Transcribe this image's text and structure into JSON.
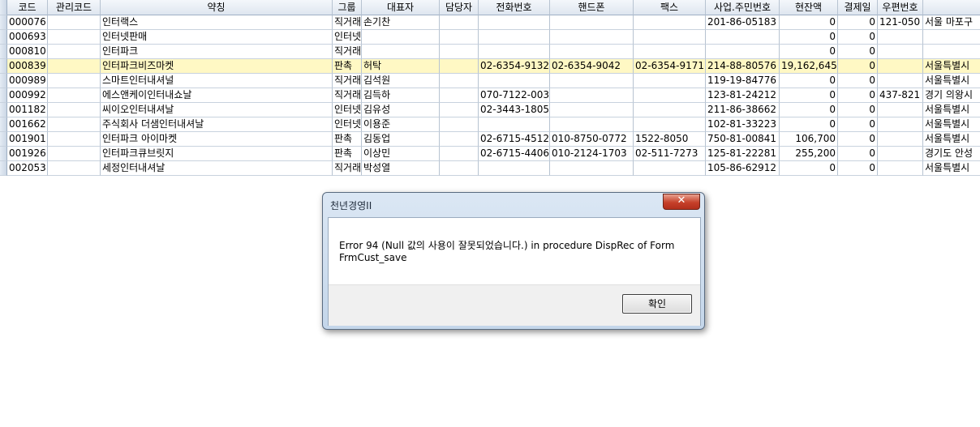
{
  "grid": {
    "headers": [
      "코드",
      "관리코드",
      "약칭",
      "그룹",
      "대표자",
      "담당자",
      "전화번호",
      "핸드폰",
      "팩스",
      "사업.주민번호",
      "현잔액",
      "결제일",
      "우편번호",
      ""
    ],
    "rows": [
      [
        "000076",
        "",
        "인터랙스",
        "직거래",
        "손기찬",
        "",
        "",
        "",
        "",
        "201-86-05183",
        "0",
        "0",
        "121-050",
        "서울 마포구"
      ],
      [
        "000693",
        "",
        "인터넷판매",
        "인터넷",
        "",
        "",
        "",
        "",
        "",
        "",
        "0",
        "0",
        "",
        ""
      ],
      [
        "000810",
        "",
        "인터파크",
        "직거래",
        "",
        "",
        "",
        "",
        "",
        "",
        "0",
        "0",
        "",
        ""
      ],
      [
        "000839",
        "",
        "인터파크비즈마켓",
        "판촉",
        "허탁",
        "",
        "02-6354-9132",
        "02-6354-9042",
        "02-6354-9171",
        "214-88-80576",
        "19,162,645",
        "0",
        "",
        "서울특별시"
      ],
      [
        "000989",
        "",
        "스마트인터내셔널",
        "직거래",
        "김석원",
        "",
        "",
        "",
        "",
        "119-19-84776",
        "0",
        "0",
        "",
        "서울특별시"
      ],
      [
        "000992",
        "",
        "에스앤케이인터내쇼날",
        "직거래",
        "김득하",
        "",
        "070-7122-003",
        "",
        "",
        "123-81-24212",
        "0",
        "0",
        "437-821",
        "경기 의왕시"
      ],
      [
        "001182",
        "",
        "씨이오인터내셔날",
        "인터넷",
        "김유성",
        "",
        "02-3443-1805",
        "",
        "",
        "211-86-38662",
        "0",
        "0",
        "",
        "서울특별시"
      ],
      [
        "001662",
        "",
        "주식회사 더샘인터내셔날",
        "인터넷",
        "이용준",
        "",
        "",
        "",
        "",
        "102-81-33223",
        "0",
        "0",
        "",
        "서울특별시"
      ],
      [
        "001901",
        "",
        "인터파크 아이마켓",
        "판촉",
        "김동업",
        "",
        "02-6715-4512",
        "010-8750-0772",
        "1522-8050",
        "750-81-00841",
        "106,700",
        "0",
        "",
        "서울특별시"
      ],
      [
        "001926",
        "",
        "인터파크큐브릿지",
        "판촉",
        "이상민",
        "",
        "02-6715-4406",
        "010-2124-1703",
        "02-511-7273",
        "125-81-22281",
        "255,200",
        "0",
        "",
        "경기도 안성"
      ],
      [
        "002053",
        "",
        "세정인터내셔날",
        "직거래",
        "박성열",
        "",
        "",
        "",
        "",
        "105-86-62912",
        "0",
        "0",
        "",
        "서울특별시"
      ]
    ]
  },
  "dialog": {
    "title": "천년경영II",
    "message": "Error 94 (Null 값의 사용이 잘못되었습니다.) in procedure DispRec of Form FrmCust_save",
    "ok_label": "확인",
    "close_glyph": "✕"
  }
}
